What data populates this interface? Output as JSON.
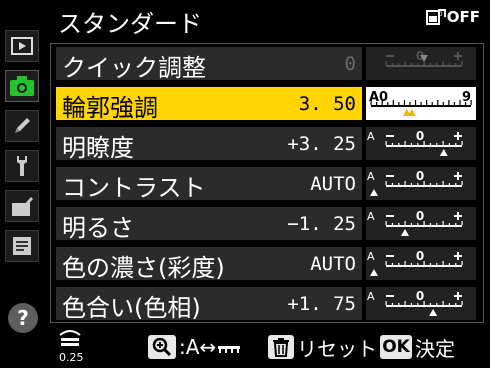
{
  "header": {
    "title": "スタンダード",
    "status_text": "OFF",
    "status_icon": "active-d-lighting-icon"
  },
  "sidebar": {
    "tabs": [
      {
        "icon": "playback-icon"
      },
      {
        "icon": "camera-icon",
        "active": true
      },
      {
        "icon": "pencil-icon"
      },
      {
        "icon": "wrench-icon"
      },
      {
        "icon": "retouch-icon"
      },
      {
        "icon": "my-menu-icon"
      }
    ],
    "help_label": "?"
  },
  "rows": [
    {
      "label": "クイック調整",
      "value": "0",
      "dim": true,
      "scale": "quick",
      "marker": 0.5,
      "selected": false
    },
    {
      "label": "輪郭強調",
      "value": "3. 50",
      "scale": "sharp",
      "marker": 0.389,
      "selected": true,
      "scale_left": "A0",
      "scale_right": "9"
    },
    {
      "label": "明瞭度",
      "value": "+3. 25",
      "scale": "pm",
      "marker": 0.76,
      "selected": false
    },
    {
      "label": "コントラスト",
      "value": "AUTO",
      "scale": "pm",
      "marker": 0.0,
      "auto": true,
      "selected": false
    },
    {
      "label": "明るさ",
      "value": "−1. 25",
      "scale": "pm",
      "marker": 0.25,
      "selected": false
    },
    {
      "label": "色の濃さ(彩度)",
      "value": "AUTO",
      "scale": "pm",
      "marker": 0.0,
      "auto": true,
      "selected": false
    },
    {
      "label": "色合い(色相)",
      "value": "+1. 75",
      "scale": "pm",
      "marker": 0.62,
      "selected": false
    }
  ],
  "footer": {
    "speed_value": "0.25",
    "zoom_hint": ":A↔",
    "reset_label": "リセット",
    "ok_key": "OK",
    "ok_label": "決定"
  },
  "colors": {
    "highlight": "#ffd400",
    "marker": "#ffffff",
    "highlight_marker": "#e6b800"
  }
}
